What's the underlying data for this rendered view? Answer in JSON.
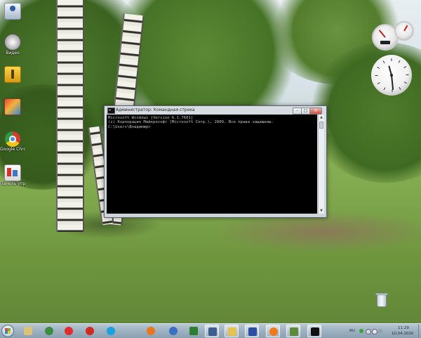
{
  "desktop": {
    "icons": [
      {
        "label": ""
      },
      {
        "label": "Видео"
      },
      {
        "label": ""
      },
      {
        "label": ""
      },
      {
        "label": "Google Chrome"
      },
      {
        "label": "Панель управления"
      }
    ],
    "recycle_bin_label": ""
  },
  "window": {
    "title": "Администратор: Командная строка",
    "console_lines": [
      "Microsoft Windows [Version 6.1.7601]",
      "(c) Корпорация Майкрософт (Microsoft Corp.), 2009. Все права защищены.",
      "",
      "C:\\Users\\Владимир>"
    ],
    "controls": {
      "minimize": "–",
      "maximize": "□",
      "close": "✕"
    }
  },
  "clock_gadget": {
    "hour": 11,
    "minute": 29
  },
  "taskbar": {
    "pinned": [
      {
        "icon": "explorer-icon",
        "color": "#d9c27a"
      },
      {
        "icon": "chrome-icon",
        "color": "#3a8d3e"
      },
      {
        "icon": "yandex-browser-icon",
        "color": "#e22b2b"
      },
      {
        "icon": "opera-icon",
        "color": "#d2281f"
      },
      {
        "icon": "skype-icon",
        "color": "#1aa0e0"
      },
      {
        "icon": "firefox-icon",
        "color": "#e8781e"
      },
      {
        "icon": "app-icon",
        "color": "#3a6fc4"
      },
      {
        "icon": "excel-icon",
        "color": "#2e7d32"
      },
      {
        "icon": "media-player-icon",
        "color": "#3d5f8f"
      },
      {
        "icon": "folder-icon",
        "color": "#e5c150"
      },
      {
        "icon": "save-icon",
        "color": "#2b4fa0"
      },
      {
        "icon": "firefox-icon",
        "color": "#f07a1a"
      },
      {
        "icon": "image-viewer-icon",
        "color": "#5c8a3a"
      },
      {
        "icon": "cmd-icon",
        "color": "#111111"
      }
    ],
    "tray": {
      "language": "RU",
      "time": "11:29",
      "date": "10.04.2020"
    }
  }
}
